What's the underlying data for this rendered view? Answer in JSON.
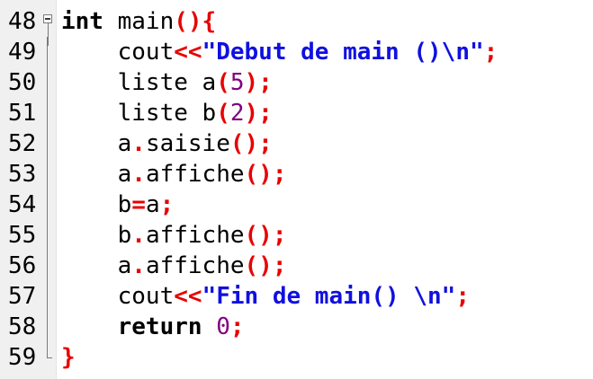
{
  "colors": {
    "operator": "#e80000",
    "string": "#1010e0",
    "number": "#800080",
    "identifier": "#000000",
    "gutter": "#f0f0f0"
  },
  "lines": [
    {
      "number": "48",
      "fold": "open",
      "indent": "",
      "tokens": [
        {
          "t": "kw",
          "v": "int"
        },
        {
          "t": "id",
          "v": " main"
        },
        {
          "t": "op",
          "v": "(){"
        }
      ]
    },
    {
      "number": "49",
      "fold": "line",
      "indent": "    ",
      "tokens": [
        {
          "t": "id",
          "v": "cout"
        },
        {
          "t": "op",
          "v": "<<"
        },
        {
          "t": "str",
          "v": "\"Debut de main ()\\n\""
        },
        {
          "t": "op",
          "v": ";"
        }
      ]
    },
    {
      "number": "50",
      "fold": "line",
      "indent": "    ",
      "tokens": [
        {
          "t": "id",
          "v": "liste a"
        },
        {
          "t": "op",
          "v": "("
        },
        {
          "t": "num",
          "v": "5"
        },
        {
          "t": "op",
          "v": ");"
        }
      ]
    },
    {
      "number": "51",
      "fold": "line",
      "indent": "    ",
      "tokens": [
        {
          "t": "id",
          "v": "liste b"
        },
        {
          "t": "op",
          "v": "("
        },
        {
          "t": "num",
          "v": "2"
        },
        {
          "t": "op",
          "v": ");"
        }
      ]
    },
    {
      "number": "52",
      "fold": "line",
      "indent": "    ",
      "tokens": [
        {
          "t": "id",
          "v": "a"
        },
        {
          "t": "op",
          "v": "."
        },
        {
          "t": "id",
          "v": "saisie"
        },
        {
          "t": "op",
          "v": "();"
        }
      ]
    },
    {
      "number": "53",
      "fold": "line",
      "indent": "    ",
      "tokens": [
        {
          "t": "id",
          "v": "a"
        },
        {
          "t": "op",
          "v": "."
        },
        {
          "t": "id",
          "v": "affiche"
        },
        {
          "t": "op",
          "v": "();"
        }
      ]
    },
    {
      "number": "54",
      "fold": "line",
      "indent": "    ",
      "tokens": [
        {
          "t": "id",
          "v": "b"
        },
        {
          "t": "op",
          "v": "="
        },
        {
          "t": "id",
          "v": "a"
        },
        {
          "t": "op",
          "v": ";"
        }
      ]
    },
    {
      "number": "55",
      "fold": "line",
      "indent": "    ",
      "tokens": [
        {
          "t": "id",
          "v": "b"
        },
        {
          "t": "op",
          "v": "."
        },
        {
          "t": "id",
          "v": "affiche"
        },
        {
          "t": "op",
          "v": "();"
        }
      ]
    },
    {
      "number": "56",
      "fold": "line",
      "indent": "    ",
      "tokens": [
        {
          "t": "id",
          "v": "a"
        },
        {
          "t": "op",
          "v": "."
        },
        {
          "t": "id",
          "v": "affiche"
        },
        {
          "t": "op",
          "v": "();"
        }
      ]
    },
    {
      "number": "57",
      "fold": "line",
      "indent": "    ",
      "tokens": [
        {
          "t": "id",
          "v": "cout"
        },
        {
          "t": "op",
          "v": "<<"
        },
        {
          "t": "str",
          "v": "\"Fin de main() \\n\""
        },
        {
          "t": "op",
          "v": ";"
        }
      ]
    },
    {
      "number": "58",
      "fold": "line",
      "indent": "    ",
      "tokens": [
        {
          "t": "kw",
          "v": "return"
        },
        {
          "t": "id",
          "v": " "
        },
        {
          "t": "num",
          "v": "0"
        },
        {
          "t": "op",
          "v": ";"
        }
      ]
    },
    {
      "number": "59",
      "fold": "end",
      "indent": "",
      "tokens": [
        {
          "t": "op",
          "v": "}"
        }
      ]
    }
  ]
}
